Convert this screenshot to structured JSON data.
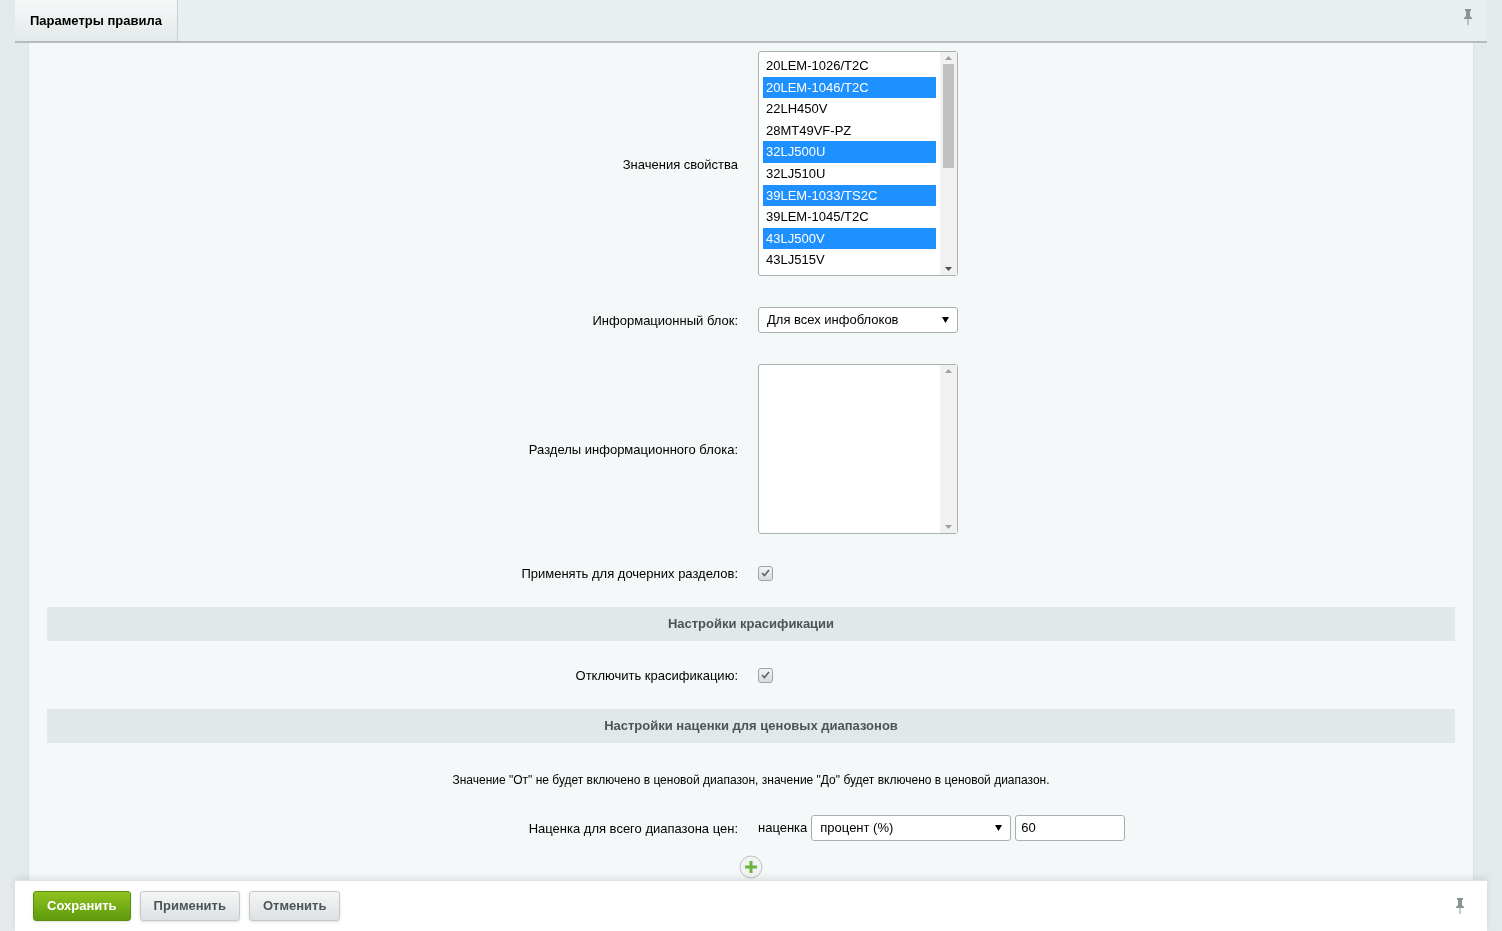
{
  "tabs": [
    {
      "label": "Параметры правила",
      "selected": true
    }
  ],
  "property_values": {
    "label": "Значения свойства",
    "options": [
      {
        "text": "20LEM-1026/T2C",
        "selected": false
      },
      {
        "text": "20LEM-1046/T2C",
        "selected": true
      },
      {
        "text": "22LH450V",
        "selected": false
      },
      {
        "text": "28MT49VF-PZ",
        "selected": false
      },
      {
        "text": "32LJ500U",
        "selected": true
      },
      {
        "text": "32LJ510U",
        "selected": false
      },
      {
        "text": "39LEM-1033/TS2C",
        "selected": true
      },
      {
        "text": "39LEM-1045/T2C",
        "selected": false
      },
      {
        "text": "43LJ500V",
        "selected": true
      },
      {
        "text": "43LJ515V",
        "selected": false
      }
    ]
  },
  "iblock": {
    "label": "Информационный блок:",
    "value": "Для всех инфоблоков"
  },
  "iblock_sections": {
    "label": "Разделы информационного блока:"
  },
  "apply_children": {
    "label": "Применять для дочерних разделов:",
    "checked": true
  },
  "sections": [
    {
      "title": "Настройки красификации",
      "fields": [
        {
          "kind": "checkbox",
          "label": "Отключить красификацию:",
          "checked": true
        }
      ]
    },
    {
      "title": "Настройки наценки для ценовых диапазонов",
      "note": "Значение \"От\" не будет включено в ценовой диапазон, значение \"До\" будет включено в ценовой диапазон.",
      "fields": [
        {
          "kind": "markup",
          "label": "Наценка для всего диапазона цен:",
          "prefix": "наценка",
          "type": "процент (%)",
          "value": "60"
        }
      ]
    }
  ],
  "buttons": [
    {
      "label": "Сохранить",
      "kind": "primary"
    },
    {
      "label": "Применить",
      "kind": "default"
    },
    {
      "label": "Отменить",
      "kind": "default"
    }
  ]
}
